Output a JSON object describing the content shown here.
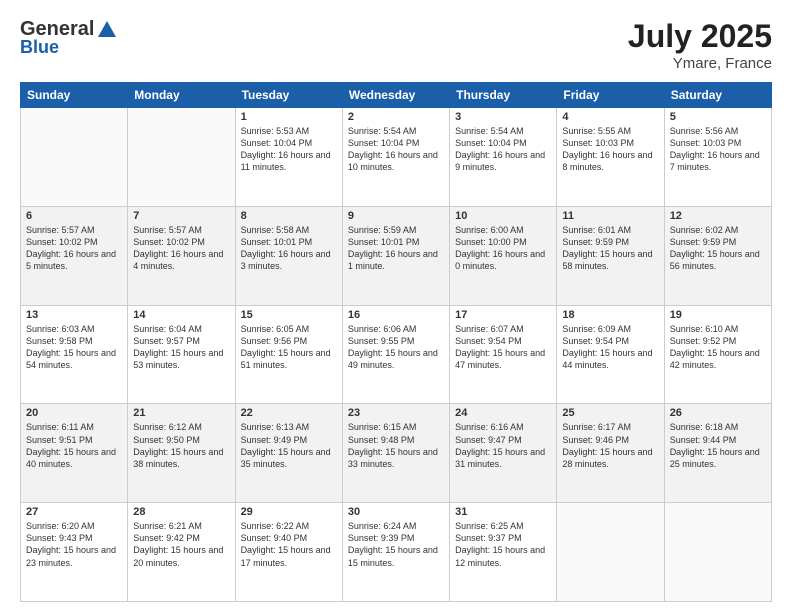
{
  "header": {
    "logo_general": "General",
    "logo_blue": "Blue",
    "month_title": "July 2025",
    "location": "Ymare, France"
  },
  "days_of_week": [
    "Sunday",
    "Monday",
    "Tuesday",
    "Wednesday",
    "Thursday",
    "Friday",
    "Saturday"
  ],
  "weeks": [
    {
      "shaded": false,
      "days": [
        {
          "num": "",
          "info": ""
        },
        {
          "num": "",
          "info": ""
        },
        {
          "num": "1",
          "info": "Sunrise: 5:53 AM\nSunset: 10:04 PM\nDaylight: 16 hours and 11 minutes."
        },
        {
          "num": "2",
          "info": "Sunrise: 5:54 AM\nSunset: 10:04 PM\nDaylight: 16 hours and 10 minutes."
        },
        {
          "num": "3",
          "info": "Sunrise: 5:54 AM\nSunset: 10:04 PM\nDaylight: 16 hours and 9 minutes."
        },
        {
          "num": "4",
          "info": "Sunrise: 5:55 AM\nSunset: 10:03 PM\nDaylight: 16 hours and 8 minutes."
        },
        {
          "num": "5",
          "info": "Sunrise: 5:56 AM\nSunset: 10:03 PM\nDaylight: 16 hours and 7 minutes."
        }
      ]
    },
    {
      "shaded": true,
      "days": [
        {
          "num": "6",
          "info": "Sunrise: 5:57 AM\nSunset: 10:02 PM\nDaylight: 16 hours and 5 minutes."
        },
        {
          "num": "7",
          "info": "Sunrise: 5:57 AM\nSunset: 10:02 PM\nDaylight: 16 hours and 4 minutes."
        },
        {
          "num": "8",
          "info": "Sunrise: 5:58 AM\nSunset: 10:01 PM\nDaylight: 16 hours and 3 minutes."
        },
        {
          "num": "9",
          "info": "Sunrise: 5:59 AM\nSunset: 10:01 PM\nDaylight: 16 hours and 1 minute."
        },
        {
          "num": "10",
          "info": "Sunrise: 6:00 AM\nSunset: 10:00 PM\nDaylight: 16 hours and 0 minutes."
        },
        {
          "num": "11",
          "info": "Sunrise: 6:01 AM\nSunset: 9:59 PM\nDaylight: 15 hours and 58 minutes."
        },
        {
          "num": "12",
          "info": "Sunrise: 6:02 AM\nSunset: 9:59 PM\nDaylight: 15 hours and 56 minutes."
        }
      ]
    },
    {
      "shaded": false,
      "days": [
        {
          "num": "13",
          "info": "Sunrise: 6:03 AM\nSunset: 9:58 PM\nDaylight: 15 hours and 54 minutes."
        },
        {
          "num": "14",
          "info": "Sunrise: 6:04 AM\nSunset: 9:57 PM\nDaylight: 15 hours and 53 minutes."
        },
        {
          "num": "15",
          "info": "Sunrise: 6:05 AM\nSunset: 9:56 PM\nDaylight: 15 hours and 51 minutes."
        },
        {
          "num": "16",
          "info": "Sunrise: 6:06 AM\nSunset: 9:55 PM\nDaylight: 15 hours and 49 minutes."
        },
        {
          "num": "17",
          "info": "Sunrise: 6:07 AM\nSunset: 9:54 PM\nDaylight: 15 hours and 47 minutes."
        },
        {
          "num": "18",
          "info": "Sunrise: 6:09 AM\nSunset: 9:54 PM\nDaylight: 15 hours and 44 minutes."
        },
        {
          "num": "19",
          "info": "Sunrise: 6:10 AM\nSunset: 9:52 PM\nDaylight: 15 hours and 42 minutes."
        }
      ]
    },
    {
      "shaded": true,
      "days": [
        {
          "num": "20",
          "info": "Sunrise: 6:11 AM\nSunset: 9:51 PM\nDaylight: 15 hours and 40 minutes."
        },
        {
          "num": "21",
          "info": "Sunrise: 6:12 AM\nSunset: 9:50 PM\nDaylight: 15 hours and 38 minutes."
        },
        {
          "num": "22",
          "info": "Sunrise: 6:13 AM\nSunset: 9:49 PM\nDaylight: 15 hours and 35 minutes."
        },
        {
          "num": "23",
          "info": "Sunrise: 6:15 AM\nSunset: 9:48 PM\nDaylight: 15 hours and 33 minutes."
        },
        {
          "num": "24",
          "info": "Sunrise: 6:16 AM\nSunset: 9:47 PM\nDaylight: 15 hours and 31 minutes."
        },
        {
          "num": "25",
          "info": "Sunrise: 6:17 AM\nSunset: 9:46 PM\nDaylight: 15 hours and 28 minutes."
        },
        {
          "num": "26",
          "info": "Sunrise: 6:18 AM\nSunset: 9:44 PM\nDaylight: 15 hours and 25 minutes."
        }
      ]
    },
    {
      "shaded": false,
      "days": [
        {
          "num": "27",
          "info": "Sunrise: 6:20 AM\nSunset: 9:43 PM\nDaylight: 15 hours and 23 minutes."
        },
        {
          "num": "28",
          "info": "Sunrise: 6:21 AM\nSunset: 9:42 PM\nDaylight: 15 hours and 20 minutes."
        },
        {
          "num": "29",
          "info": "Sunrise: 6:22 AM\nSunset: 9:40 PM\nDaylight: 15 hours and 17 minutes."
        },
        {
          "num": "30",
          "info": "Sunrise: 6:24 AM\nSunset: 9:39 PM\nDaylight: 15 hours and 15 minutes."
        },
        {
          "num": "31",
          "info": "Sunrise: 6:25 AM\nSunset: 9:37 PM\nDaylight: 15 hours and 12 minutes."
        },
        {
          "num": "",
          "info": ""
        },
        {
          "num": "",
          "info": ""
        }
      ]
    }
  ]
}
